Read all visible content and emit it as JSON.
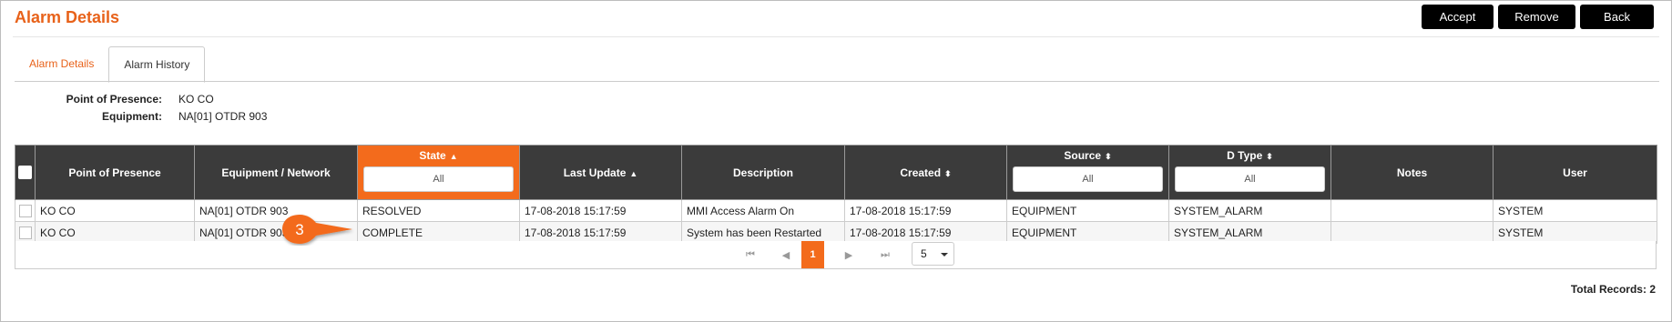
{
  "title": "Alarm Details",
  "buttons": {
    "accept": "Accept",
    "remove": "Remove",
    "back": "Back"
  },
  "tabs": [
    {
      "label": "Alarm Details",
      "active": false
    },
    {
      "label": "Alarm History",
      "active": true
    }
  ],
  "info": {
    "pop_label": "Point of Presence:",
    "pop_value": "KO CO",
    "equipment_label": "Equipment:",
    "equipment_value": "NA[01] OTDR 903"
  },
  "table": {
    "columns": [
      "Point of Presence",
      "Equipment / Network",
      "State",
      "Last Update",
      "Description",
      "Created",
      "Source",
      "D Type",
      "Notes",
      "User"
    ],
    "filters": {
      "state": "All",
      "source": "All",
      "dtype": "All"
    },
    "rows": [
      {
        "pop": "KO CO",
        "equipment": "NA[01] OTDR 903",
        "state": "RESOLVED",
        "last_update": "17-08-2018 15:17:59",
        "description": "MMI Access Alarm On",
        "created": "17-08-2018 15:17:59",
        "source": "EQUIPMENT",
        "dtype": "SYSTEM_ALARM",
        "notes": "",
        "user": "SYSTEM"
      },
      {
        "pop": "KO CO",
        "equipment": "NA[01] OTDR 903",
        "state": "COMPLETE",
        "last_update": "17-08-2018 15:17:59",
        "description": "System has been Restarted",
        "created": "17-08-2018 15:17:59",
        "source": "EQUIPMENT",
        "dtype": "SYSTEM_ALARM",
        "notes": "",
        "user": "SYSTEM"
      }
    ]
  },
  "pager": {
    "current_page": "1",
    "page_size": "5"
  },
  "total_records": "Total Records: 2",
  "callout": {
    "number": "3"
  },
  "colors": {
    "accent": "#f36b1c",
    "title": "#e8621a",
    "header_bg": "#3b3b3b",
    "resolved": "#2a8a2a"
  },
  "icons": {
    "first": "first-page-icon",
    "prev": "prev-page-icon",
    "next": "next-page-icon",
    "last": "last-page-icon",
    "sort": "sort-icon"
  }
}
